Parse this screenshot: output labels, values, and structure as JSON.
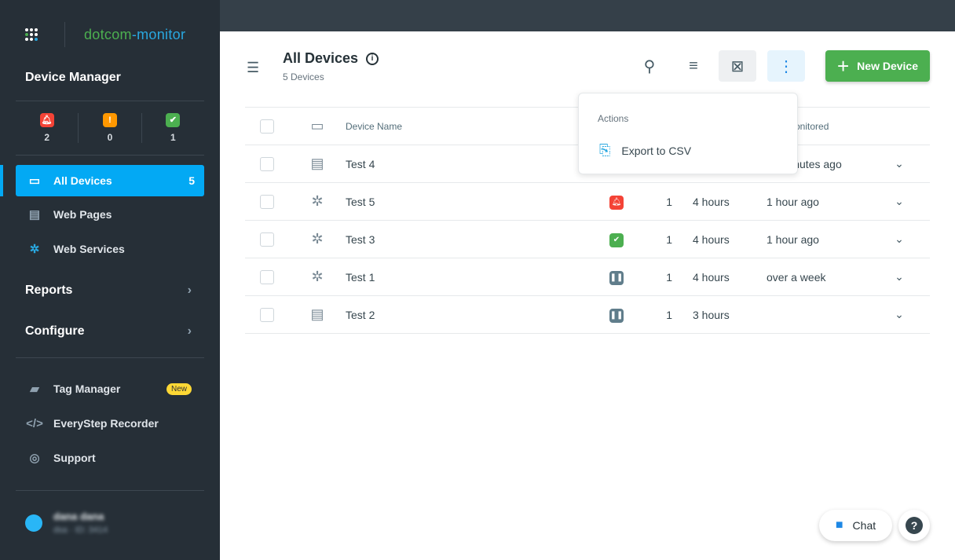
{
  "brand": {
    "part1": "dotcom",
    "part2": "-monitor"
  },
  "sidebar": {
    "title": "Device Manager",
    "counts": [
      {
        "icon": "bell-icon",
        "color": "#f44336",
        "value": "2"
      },
      {
        "icon": "exclamation-icon",
        "color": "#ff9800",
        "value": "0"
      },
      {
        "icon": "check-icon",
        "color": "#4caf50",
        "value": "1"
      }
    ],
    "nav": [
      {
        "label": "All Devices",
        "count": "5"
      },
      {
        "label": "Web Pages"
      },
      {
        "label": "Web Services"
      }
    ],
    "sections": [
      {
        "label": "Reports"
      },
      {
        "label": "Configure"
      }
    ],
    "tools": [
      {
        "label": "Tag Manager",
        "badge": "New"
      },
      {
        "label": "EveryStep Recorder"
      },
      {
        "label": "Support"
      }
    ],
    "user": {
      "name": "dana dana",
      "sub": "dsa · ID: 3414"
    }
  },
  "header": {
    "title": "All Devices",
    "subtitle": "5 Devices",
    "new_device": "New Device"
  },
  "table": {
    "headers": {
      "device_name": "Device Name",
      "last_monitored": "Last Monitored"
    },
    "rows": [
      {
        "type": "web-page",
        "name": "Test 4",
        "status": "",
        "count": "",
        "frequency": "",
        "last": "52 minutes ago"
      },
      {
        "type": "web-service",
        "name": "Test 5",
        "status": "alert",
        "count": "1",
        "frequency": "4 hours",
        "last": "1 hour ago"
      },
      {
        "type": "web-service",
        "name": "Test 3",
        "status": "ok",
        "count": "1",
        "frequency": "4 hours",
        "last": "1 hour ago"
      },
      {
        "type": "web-service",
        "name": "Test 1",
        "status": "paused",
        "count": "1",
        "frequency": "4 hours",
        "last": "over a week"
      },
      {
        "type": "web-page",
        "name": "Test 2",
        "status": "paused",
        "count": "1",
        "frequency": "3 hours",
        "last": ""
      }
    ]
  },
  "dropdown": {
    "heading": "Actions",
    "items": [
      {
        "label": "Export to CSV"
      }
    ]
  },
  "chat": {
    "label": "Chat"
  },
  "colors": {
    "accent": "#03a9f4",
    "success": "#4caf50",
    "alert": "#f44336",
    "warning": "#ff9800",
    "paused": "#607d8b"
  }
}
